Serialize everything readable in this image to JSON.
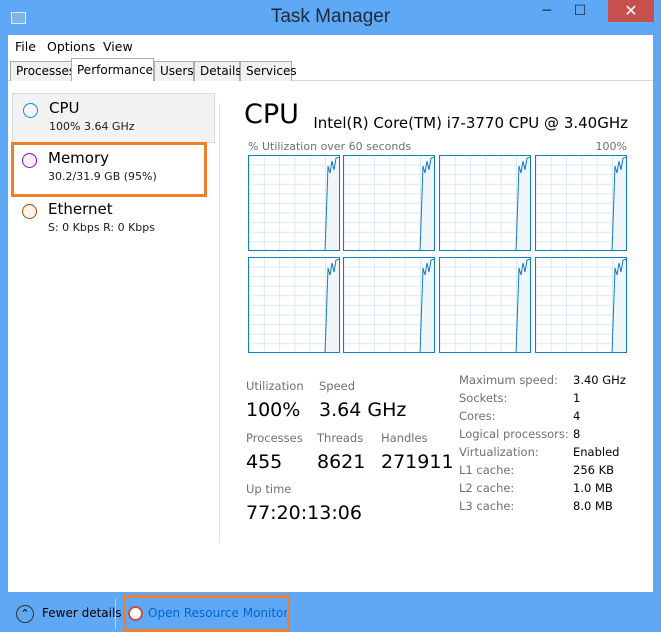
{
  "window": {
    "title": "Task Manager",
    "minimize": "─",
    "maximize": "☐",
    "close": "✕"
  },
  "menu": [
    "File",
    "Options",
    "View"
  ],
  "tabs": [
    "Processes",
    "Performance",
    "Users",
    "Details",
    "Services"
  ],
  "active_tab": "Performance",
  "sidebar": [
    {
      "name": "CPU",
      "value": "100% 3.64 GHz",
      "color": "#1e8bd2",
      "selected": true
    },
    {
      "name": "Memory",
      "value": "30.2/31.9 GB (95%)",
      "color": "#8b12ae",
      "highlighted": true
    },
    {
      "name": "Ethernet",
      "value": "S: 0 Kbps R: 0 Kbps",
      "color": "#a74f01"
    }
  ],
  "main": {
    "title": "CPU",
    "cpu_name": "Intel(R) Core(TM) i7-3770 CPU @ 3.40GHz",
    "graph_label": "% Utilization over 60 seconds",
    "graph_max": "100%",
    "graph_count": 8,
    "stats": {
      "utilization_label": "Utilization",
      "utilization": "100%",
      "speed_label": "Speed",
      "speed": "3.64 GHz",
      "processes_label": "Processes",
      "processes": "455",
      "threads_label": "Threads",
      "threads": "8621",
      "handles_label": "Handles",
      "handles": "271911",
      "uptime_label": "Up time",
      "uptime": "77:20:13:06"
    },
    "details": [
      {
        "label": "Maximum speed:",
        "value": "3.40 GHz"
      },
      {
        "label": "Sockets:",
        "value": "1"
      },
      {
        "label": "Cores:",
        "value": "4"
      },
      {
        "label": "Logical processors:",
        "value": "8"
      },
      {
        "label": "Virtualization:",
        "value": "Enabled"
      },
      {
        "label": "L1 cache:",
        "value": "256 KB"
      },
      {
        "label": "L2 cache:",
        "value": "1.0 MB"
      },
      {
        "label": "L3 cache:",
        "value": "8.0 MB"
      }
    ]
  },
  "footer": {
    "fewer_details": "Fewer details",
    "open_resource_monitor": "Open Resource Monitor"
  }
}
